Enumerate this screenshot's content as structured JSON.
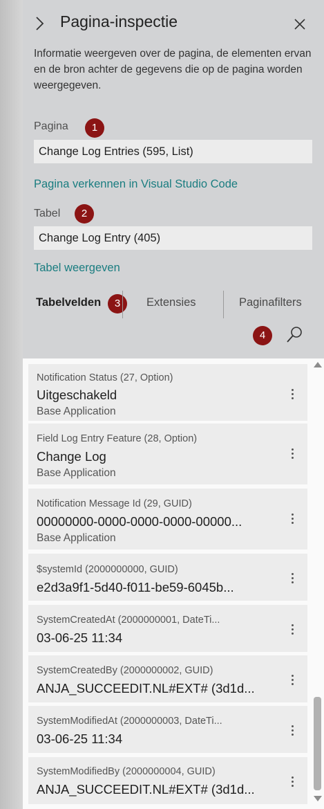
{
  "panel": {
    "title": "Pagina-inspectie",
    "description": "Informatie weergeven over de pagina, de elementen ervan en de bron achter de gegevens die op de pagina worden weergegeven."
  },
  "page_section": {
    "label": "Pagina",
    "badge": "1",
    "value": "Change Log Entries (595, List)",
    "link": "Pagina verkennen in Visual Studio Code"
  },
  "table_section": {
    "label": "Tabel",
    "badge": "2",
    "value": "Change Log Entry (405)",
    "link": "Tabel weergeven"
  },
  "tabs": [
    {
      "label": "Tabelvelden",
      "active": true,
      "badge": "3"
    },
    {
      "label": "Extensies",
      "active": false
    },
    {
      "label": "Paginafilters",
      "active": false
    }
  ],
  "search_badge": "4",
  "icons": {
    "expand": "chevron-right-icon",
    "close": "close-icon",
    "search": "search-icon",
    "more": "more-vertical-icon"
  },
  "colors": {
    "badge": "#8b1414",
    "link": "#1a7d80",
    "panel_bg": "#d2d3d5",
    "card_bg": "#ececec"
  },
  "fields": [
    {
      "meta": "Notification Status (27, Option)",
      "value": "Uitgeschakeld",
      "source": "Base Application"
    },
    {
      "meta": "Field Log Entry Feature (28, Option)",
      "value": "Change Log",
      "source": "Base Application"
    },
    {
      "meta": "Notification Message Id (29, GUID)",
      "value": "00000000-0000-0000-0000-00000...",
      "source": "Base Application"
    },
    {
      "meta": "$systemId (2000000000, GUID)",
      "value": "e2d3a9f1-5d40-f011-be59-6045b...",
      "source": ""
    },
    {
      "meta": "SystemCreatedAt (2000000001, DateTi...",
      "value": "03-06-25 11:34",
      "source": ""
    },
    {
      "meta": "SystemCreatedBy (2000000002, GUID)",
      "value": "ANJA_SUCCEEDIT.NL#EXT# (3d1d...",
      "source": ""
    },
    {
      "meta": "SystemModifiedAt (2000000003, DateTi...",
      "value": "03-06-25 11:34",
      "source": ""
    },
    {
      "meta": "SystemModifiedBy (2000000004, GUID)",
      "value": "ANJA_SUCCEEDIT.NL#EXT# (3d1d...",
      "source": ""
    }
  ]
}
